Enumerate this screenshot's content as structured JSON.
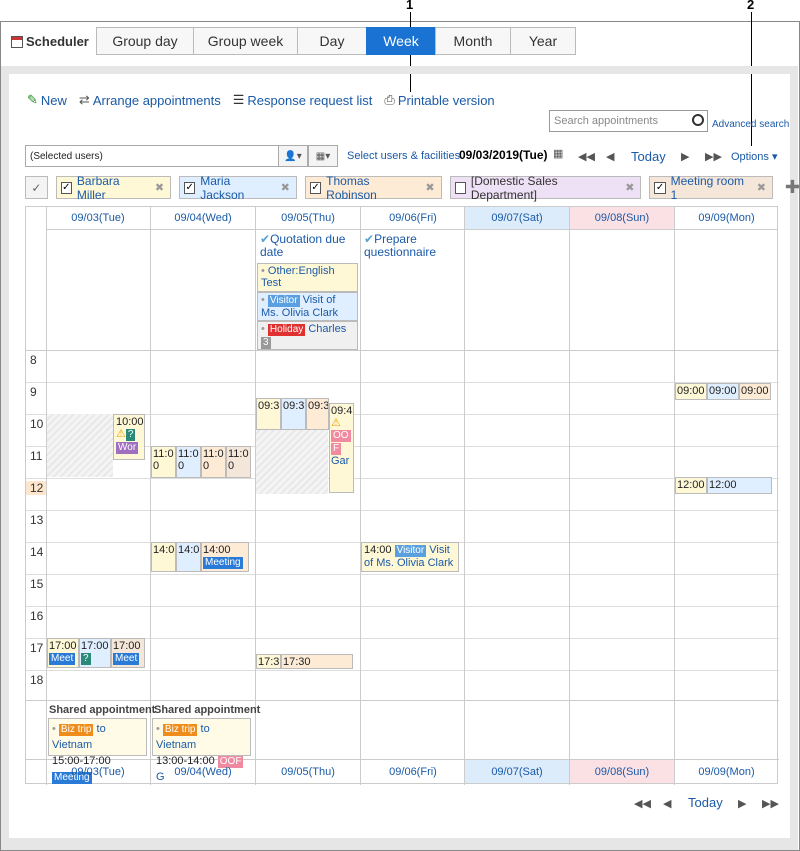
{
  "callouts": [
    "1",
    "2"
  ],
  "app": {
    "title": "Scheduler"
  },
  "tabs": [
    "Group day",
    "Group week",
    "Day",
    "Week",
    "Month",
    "Year"
  ],
  "toolbar": {
    "new": "New",
    "arrange": "Arrange appointments",
    "response": "Response request list",
    "printable": "Printable version"
  },
  "search": {
    "placeholder": "Search appointments",
    "advanced": "Advanced search"
  },
  "selection": {
    "value": "(Selected users)",
    "select_link": "Select users & facilities",
    "date": "09/03/2019(Tue)",
    "today": "Today",
    "options": "Options"
  },
  "chips": [
    {
      "label": "Barbara Miller",
      "checked": true,
      "color": "#fff8d6"
    },
    {
      "label": "Maria Jackson",
      "checked": true,
      "color": "#e0efff"
    },
    {
      "label": "Thomas Robinson",
      "checked": true,
      "color": "#fdebd6"
    },
    {
      "label": "[Domestic Sales Department]",
      "checked": false,
      "color": "#eee0f5"
    },
    {
      "label": "Meeting room 1",
      "checked": true,
      "color": "#f5e6da"
    }
  ],
  "days": [
    "09/03(Tue)",
    "09/04(Wed)",
    "09/05(Thu)",
    "09/06(Fri)",
    "09/07(Sat)",
    "09/08(Sun)",
    "09/09(Mon)"
  ],
  "hours": [
    "8",
    "9",
    "10",
    "11",
    "12",
    "13",
    "14",
    "15",
    "16",
    "17",
    "18"
  ],
  "allday": {
    "todo_thu": "Quotation due date",
    "todo_fri": "Prepare questionnaire",
    "ev1": "Other:English Test",
    "ev2_badge": "Visitor",
    "ev2_text": " Visit of Ms. Olivia Clark",
    "ev3_badge": "Holiday",
    "ev3_text": " Charles",
    "ev3_count": "3"
  },
  "events": {
    "tue_1000": "10:00",
    "tue_wor": "Wor",
    "wed_1100": "11:0",
    "wed_0": "0",
    "thu_0930": "09:3",
    "thu_094": "09:4",
    "thu_oo": "OO",
    "thu_f": "F",
    "thu_gar": "Gar",
    "mon_0900": "09:00",
    "mon_1200": "12:00",
    "wed_1400": "14:0",
    "wed_1400b": "14:00",
    "wed_meeting": "Meeting",
    "fri_1400": "14:00",
    "fri_visitor": "Visitor",
    "fri_visit": "Visit of Ms. Olivia Clark",
    "tue_1700": "17:00",
    "tue_meet": "Meet",
    "q": "?",
    "thu_173": "17:3",
    "thu_1730": "17:30"
  },
  "shared": {
    "label": "Shared appointment",
    "tue": {
      "badge": "Biz trip",
      "text": "to Vietnam",
      "time": "15:00-17:00",
      "tag": "Meeting"
    },
    "wed": {
      "badge": "Biz trip",
      "text": "to Vietnam",
      "time": "13:00-14:00",
      "tag": "OOF",
      "tail": "G"
    }
  },
  "bottom": {
    "today": "Today"
  }
}
